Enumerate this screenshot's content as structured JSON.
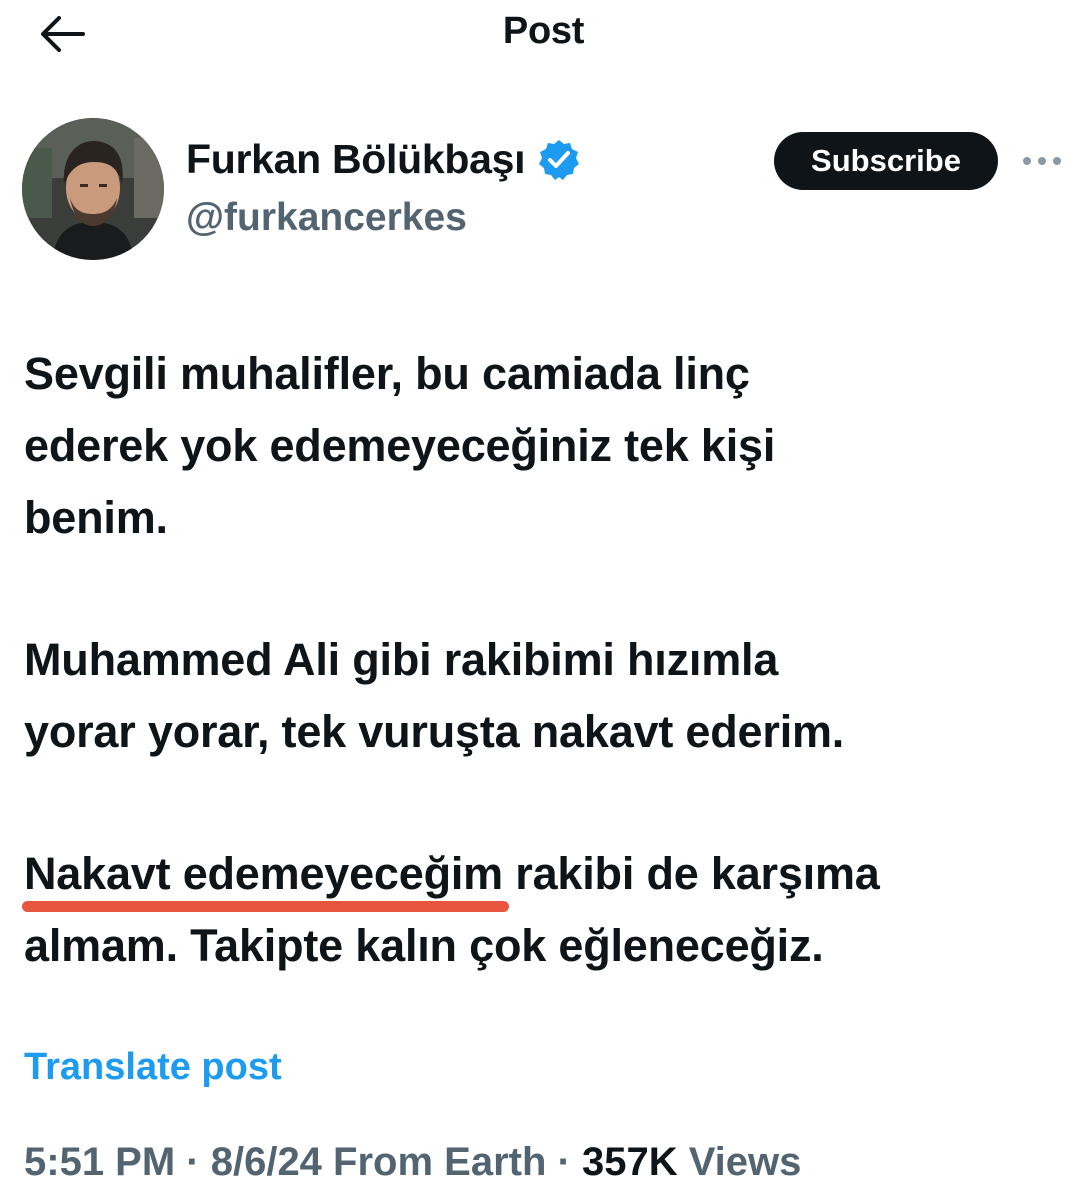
{
  "header": {
    "title": "Post",
    "back_icon": "arrow-left-icon"
  },
  "author": {
    "name": "Furkan Bölükbaşı",
    "handle": "@furkancerkes",
    "verified": true,
    "verified_color": "#1d9bf0",
    "subscribe_label": "Subscribe",
    "more_icon": "ellipsis-icon"
  },
  "post": {
    "paragraph1_line1": "Sevgili muhalifler, bu camiada linç",
    "paragraph1_line2": "ederek yok edemeyeceğiniz tek kişi",
    "paragraph1_line3": "benim.",
    "paragraph2_line1": "Muhammed Ali gibi rakibimi hızımla",
    "paragraph2_line2": "yorar yorar, tek vuruşta nakavt ederim.",
    "paragraph3_highlighted": "Nakavt edemeyeceğim",
    "paragraph3_rest": " rakibi de karşıma",
    "paragraph3_line2": "almam. Takipte kalın çok eğleneceğiz.",
    "highlight_color": "#e8553e"
  },
  "translate_label": "Translate post",
  "meta": {
    "time": "5:51 PM",
    "separator": " · ",
    "date": "8/6/24",
    "location": " From Earth",
    "views_count": "357K",
    "views_label": " Views"
  }
}
